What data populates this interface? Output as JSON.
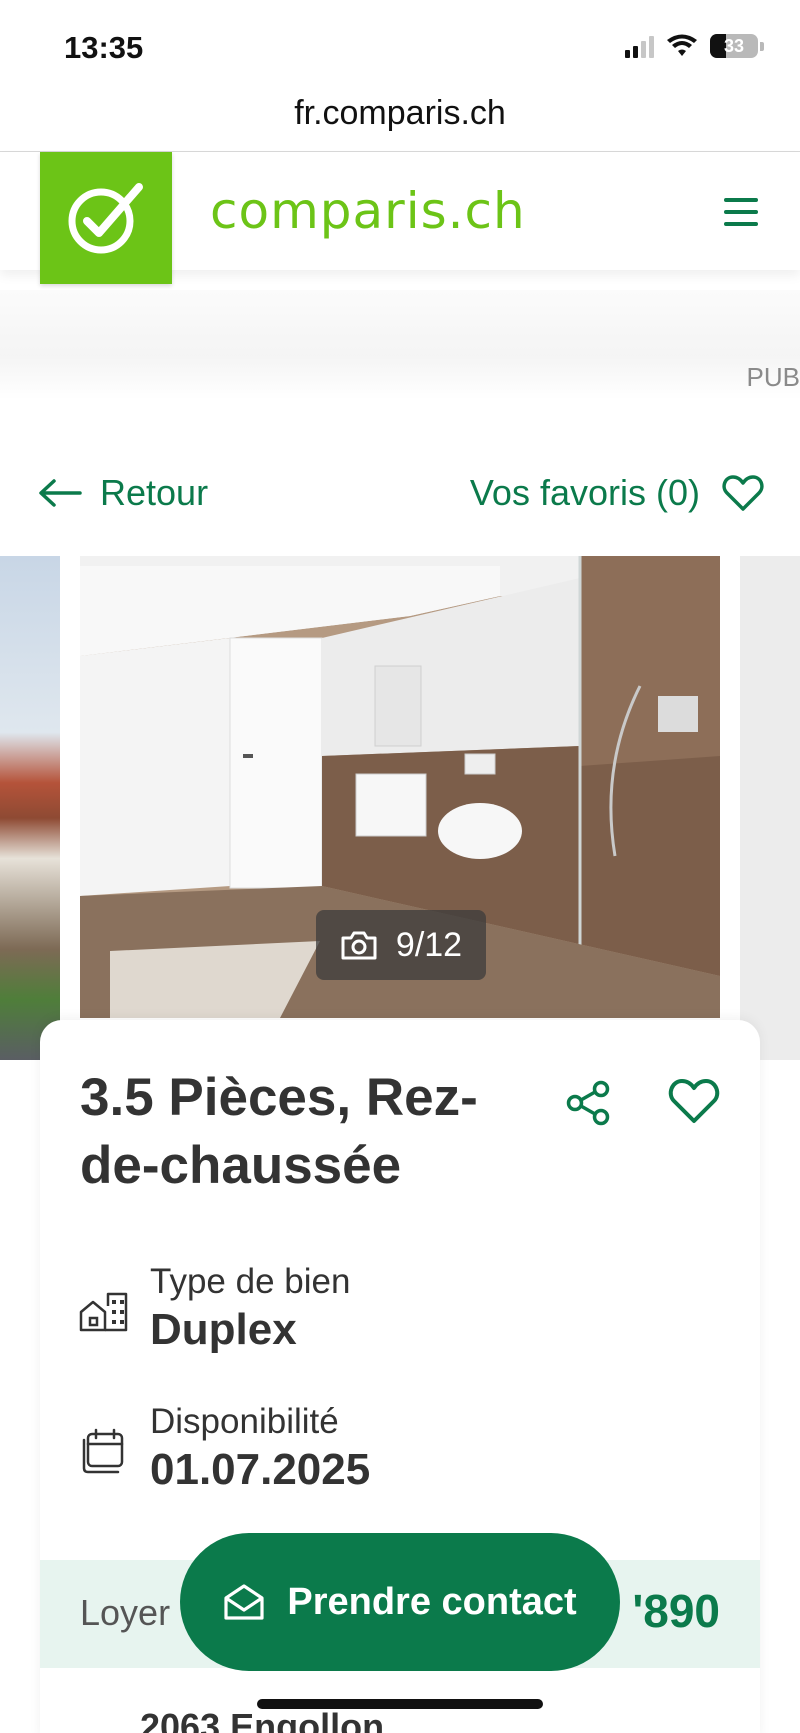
{
  "status_bar": {
    "time": "13:35",
    "battery": "33"
  },
  "browser": {
    "url": "fr.comparis.ch"
  },
  "header": {
    "brand": "comparis.ch"
  },
  "ad": {
    "label": "PUB"
  },
  "nav": {
    "back_label": "Retour",
    "favorites_label": "Vos favoris (0)"
  },
  "gallery": {
    "counter": "9/12"
  },
  "listing": {
    "title": "3.5 Pièces, Rez-de-chaussée",
    "property_type_label": "Type de bien",
    "property_type_value": "Duplex",
    "availability_label": "Disponibilité",
    "availability_value": "01.07.2025",
    "rent_label": "Loyer",
    "rent_value": "'890",
    "address": "2063 Engollon"
  },
  "cta": {
    "contact_label": "Prendre contact"
  },
  "colors": {
    "brand_green": "#6cc417",
    "accent_green": "#0b7a4b"
  },
  "icons": [
    "camera-icon",
    "share-icon",
    "heart-icon",
    "building-icon",
    "calendar-icon",
    "envelope-icon",
    "arrow-left-icon",
    "menu-icon"
  ]
}
